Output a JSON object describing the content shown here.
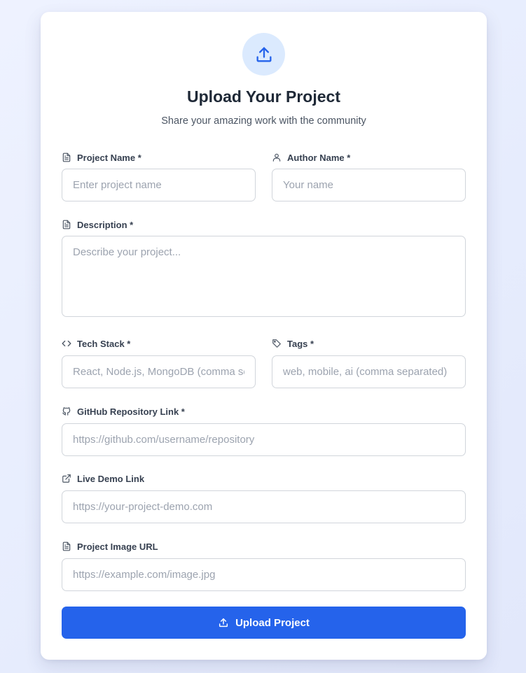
{
  "header": {
    "icon": "upload-icon",
    "title": "Upload Your Project",
    "subtitle": "Share your amazing work with the community"
  },
  "form": {
    "project_name": {
      "label": "Project Name *",
      "placeholder": "Enter project name",
      "icon": "document-icon"
    },
    "author_name": {
      "label": "Author Name *",
      "placeholder": "Your name",
      "icon": "user-icon"
    },
    "description": {
      "label": "Description *",
      "placeholder": "Describe your project...",
      "icon": "document-icon"
    },
    "tech_stack": {
      "label": "Tech Stack *",
      "placeholder": "React, Node.js, MongoDB (comma separated)",
      "icon": "code-icon"
    },
    "tags": {
      "label": "Tags *",
      "placeholder": "web, mobile, ai (comma separated)",
      "icon": "tag-icon"
    },
    "github": {
      "label": "GitHub Repository Link *",
      "placeholder": "https://github.com/username/repository",
      "icon": "github-icon"
    },
    "live_demo": {
      "label": "Live Demo Link",
      "placeholder": "https://your-project-demo.com",
      "icon": "external-link-icon"
    },
    "image_url": {
      "label": "Project Image URL",
      "placeholder": "https://example.com/image.jpg",
      "icon": "document-icon"
    },
    "submit": {
      "label": "Upload Project",
      "icon": "upload-icon"
    }
  },
  "colors": {
    "primary": "#2563eb",
    "icon_bg": "#dbeafe",
    "background": "#eef2ff"
  }
}
